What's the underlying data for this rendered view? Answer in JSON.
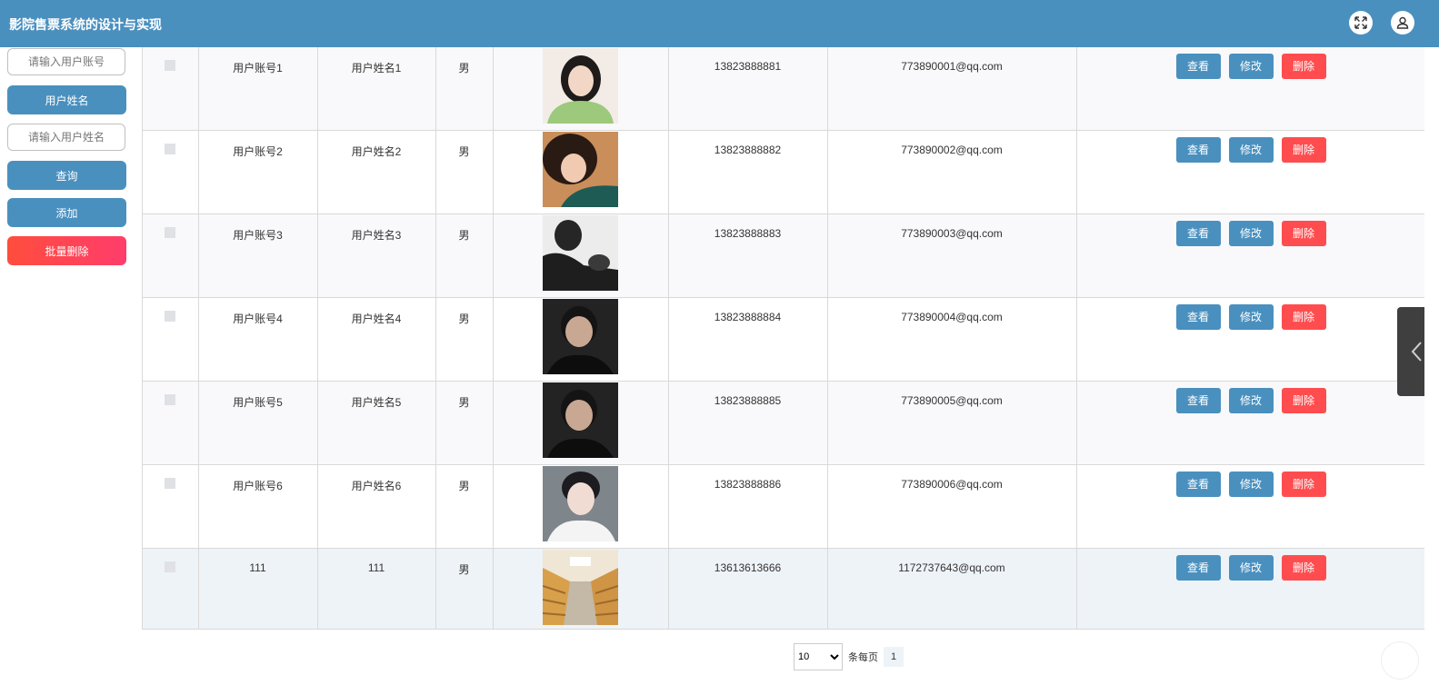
{
  "app": {
    "title": "影院售票系统的设计与实现"
  },
  "topbar": {
    "fullscreen_icon": "expand-icon",
    "user_icon": "user-icon"
  },
  "sidebar": {
    "account_placeholder": "请输入用户账号",
    "name_button": "用户姓名",
    "name_placeholder": "请输入用户姓名",
    "query_button": "查询",
    "add_button": "添加",
    "batch_delete_button": "批量删除"
  },
  "colors": {
    "primary": "#4a90bf",
    "danger": "#ff4d4f",
    "border": "#d9d9d9"
  },
  "table": {
    "actions": {
      "view": "查看",
      "edit": "修改",
      "delete": "删除"
    },
    "rows": [
      {
        "account": "用户账号1",
        "name": "用户姓名1",
        "gender": "男",
        "phone": "13823888881",
        "email": "773890001@qq.com"
      },
      {
        "account": "用户账号2",
        "name": "用户姓名2",
        "gender": "男",
        "phone": "13823888882",
        "email": "773890002@qq.com"
      },
      {
        "account": "用户账号3",
        "name": "用户姓名3",
        "gender": "男",
        "phone": "13823888883",
        "email": "773890003@qq.com"
      },
      {
        "account": "用户账号4",
        "name": "用户姓名4",
        "gender": "男",
        "phone": "13823888884",
        "email": "773890004@qq.com"
      },
      {
        "account": "用户账号5",
        "name": "用户姓名5",
        "gender": "男",
        "phone": "13823888885",
        "email": "773890005@qq.com"
      },
      {
        "account": "用户账号6",
        "name": "用户姓名6",
        "gender": "男",
        "phone": "13823888886",
        "email": "773890006@qq.com"
      },
      {
        "account": "111",
        "name": "111",
        "gender": "男",
        "phone": "13613613666",
        "email": "1172737643@qq.com"
      }
    ]
  },
  "pagination": {
    "page_size": "10",
    "page_size_options": [
      "10"
    ],
    "per_page_label": "条每页",
    "current_page": "1"
  }
}
